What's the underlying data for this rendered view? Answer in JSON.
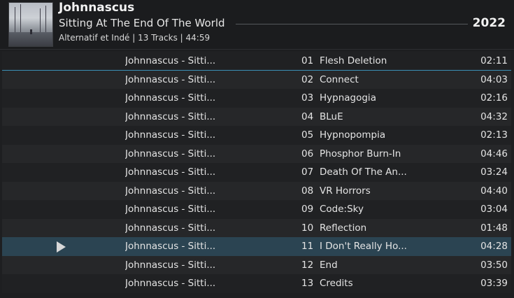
{
  "album": {
    "artist": "Johnnascus",
    "title": "Sitting At The End Of The World",
    "year": "2022",
    "meta": "Alternatif et Indé | 13 Tracks | 44:59"
  },
  "tracks": [
    {
      "name": "Johnnascus - Sitti...",
      "number": "01",
      "title": "Flesh Deletion",
      "duration": "02:11"
    },
    {
      "name": "Johnnascus - Sitti...",
      "number": "02",
      "title": "Connect",
      "duration": "04:03"
    },
    {
      "name": "Johnnascus - Sitti...",
      "number": "03",
      "title": "Hypnagogia",
      "duration": "02:16"
    },
    {
      "name": "Johnnascus - Sitti...",
      "number": "04",
      "title": "BLuE",
      "duration": "04:32"
    },
    {
      "name": "Johnnascus - Sitti...",
      "number": "05",
      "title": "Hypnopompia",
      "duration": "02:13"
    },
    {
      "name": "Johnnascus - Sitti...",
      "number": "06",
      "title": "Phosphor Burn-In",
      "duration": "04:46"
    },
    {
      "name": "Johnnascus - Sitti...",
      "number": "07",
      "title": "Death Of The An...",
      "duration": "03:24"
    },
    {
      "name": "Johnnascus - Sitti...",
      "number": "08",
      "title": "VR Horrors",
      "duration": "04:40"
    },
    {
      "name": "Johnnascus - Sitti...",
      "number": "09",
      "title": "Code:Sky",
      "duration": "03:04"
    },
    {
      "name": "Johnnascus - Sitti...",
      "number": "10",
      "title": "Reflection",
      "duration": "01:48"
    },
    {
      "name": "Johnnascus - Sitti...",
      "number": "11",
      "title": "I Don't Really Ho...",
      "duration": "04:28",
      "playing": true
    },
    {
      "name": "Johnnascus - Sitti...",
      "number": "12",
      "title": "End",
      "duration": "03:50"
    },
    {
      "name": "Johnnascus - Sitti...",
      "number": "13",
      "title": "Credits",
      "duration": "03:39"
    }
  ],
  "colors": {
    "background": "#1e1f21",
    "playing_row": "#2b4452",
    "selection_line": "#3a8fb5"
  },
  "icons": {
    "play_indicator": "play-icon"
  }
}
